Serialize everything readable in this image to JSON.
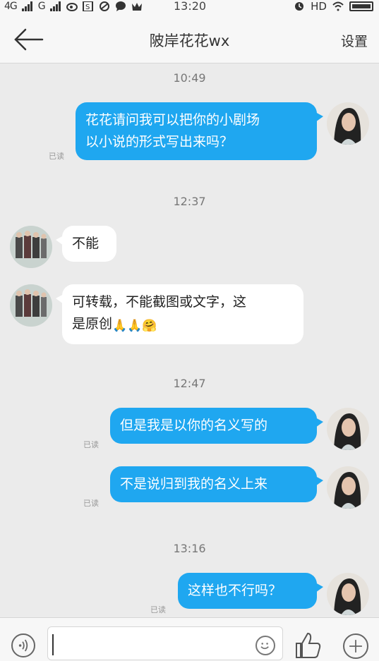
{
  "status_bar": {
    "network": "4G",
    "signal2": "G",
    "time": "13:20",
    "hd": "HD"
  },
  "nav": {
    "title": "陂岸花花wx",
    "settings": "设置"
  },
  "messages": [
    {
      "time": "10:49",
      "from": "me",
      "text": "花花请问我可以把你的小剧场\n以小说的形式写出来吗？",
      "status": "已读"
    },
    {
      "time": "12:37",
      "from": "other",
      "text": "不能"
    },
    {
      "from": "other",
      "text": "可转载，不能截图或文字，这",
      "text2": "是原创"
    },
    {
      "time": "12:47",
      "from": "me",
      "text": "但是我是以你的名义写的",
      "status": "已读"
    },
    {
      "from": "me",
      "text": "不是说归到我的名义上来",
      "status": "已读"
    },
    {
      "time": "13:16",
      "from": "me",
      "text": "这样也不行吗？",
      "status": "已读"
    }
  ],
  "emojis": [
    "🙏",
    "🙏",
    "🤗"
  ],
  "colors": {
    "me_bubble": "#1fa7f0",
    "other_bubble": "#ffffff",
    "background": "#ebebeb"
  }
}
